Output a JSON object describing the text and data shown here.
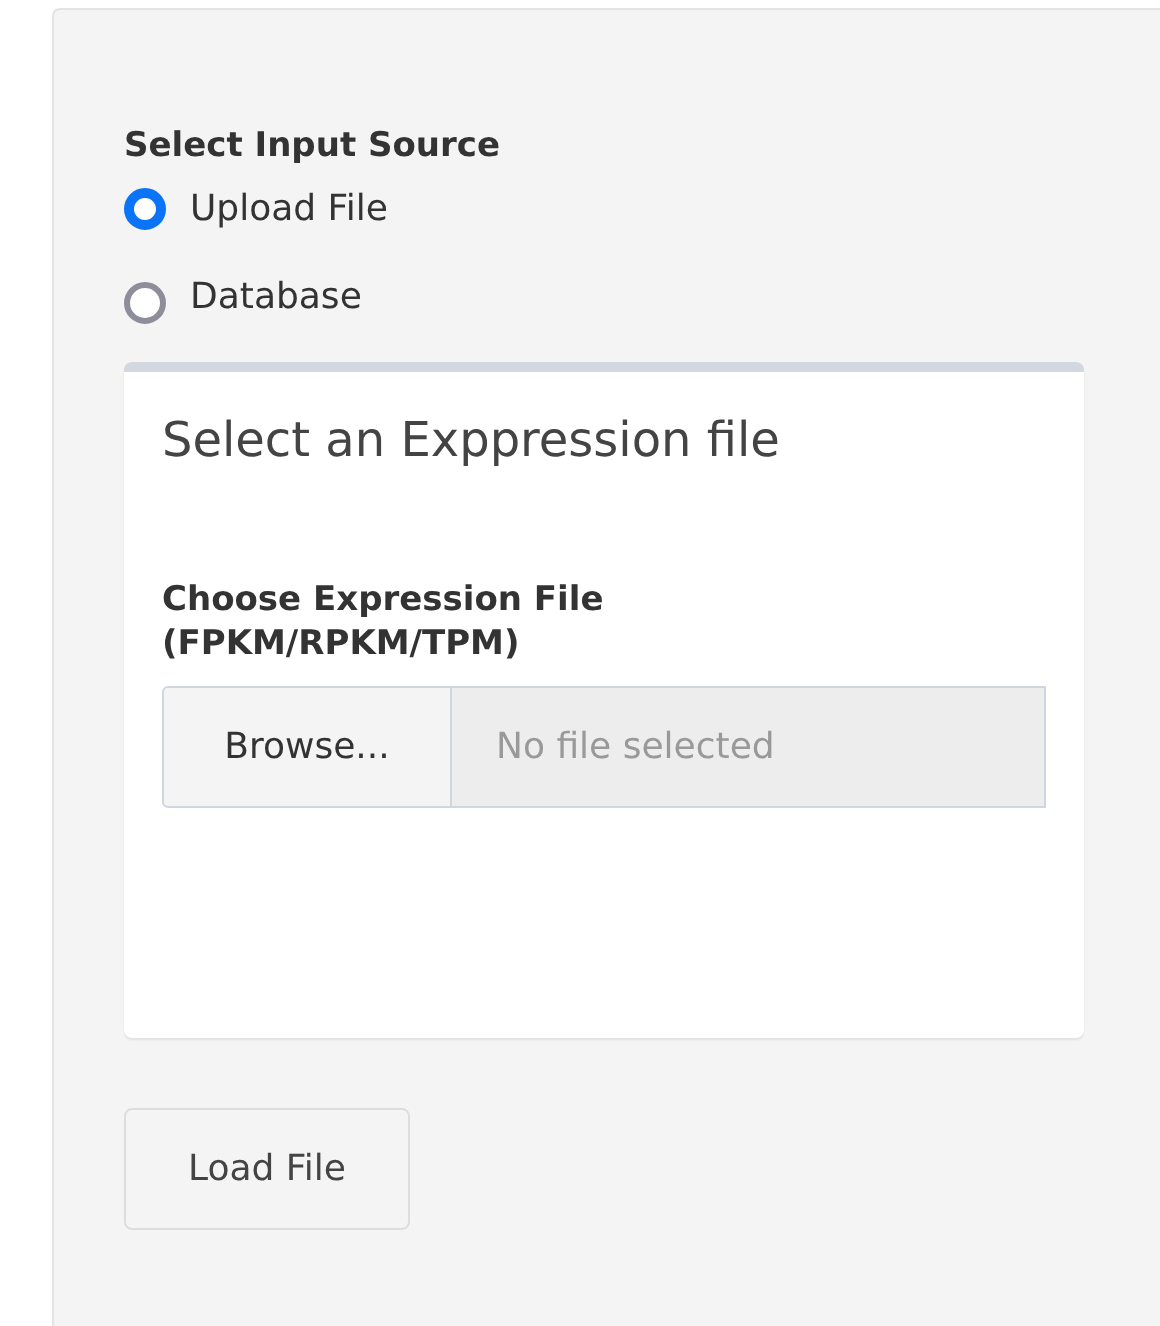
{
  "input_source": {
    "label": "Select Input Source",
    "options": [
      {
        "label": "Upload File",
        "selected": true
      },
      {
        "label": "Database",
        "selected": false
      }
    ]
  },
  "panel": {
    "title": "Select an Exppression file",
    "file_input": {
      "label": "Choose Expression File (FPKM/RPKM/TPM)",
      "button": "Browse...",
      "placeholder": "No file selected"
    }
  },
  "load_button": "Load File"
}
